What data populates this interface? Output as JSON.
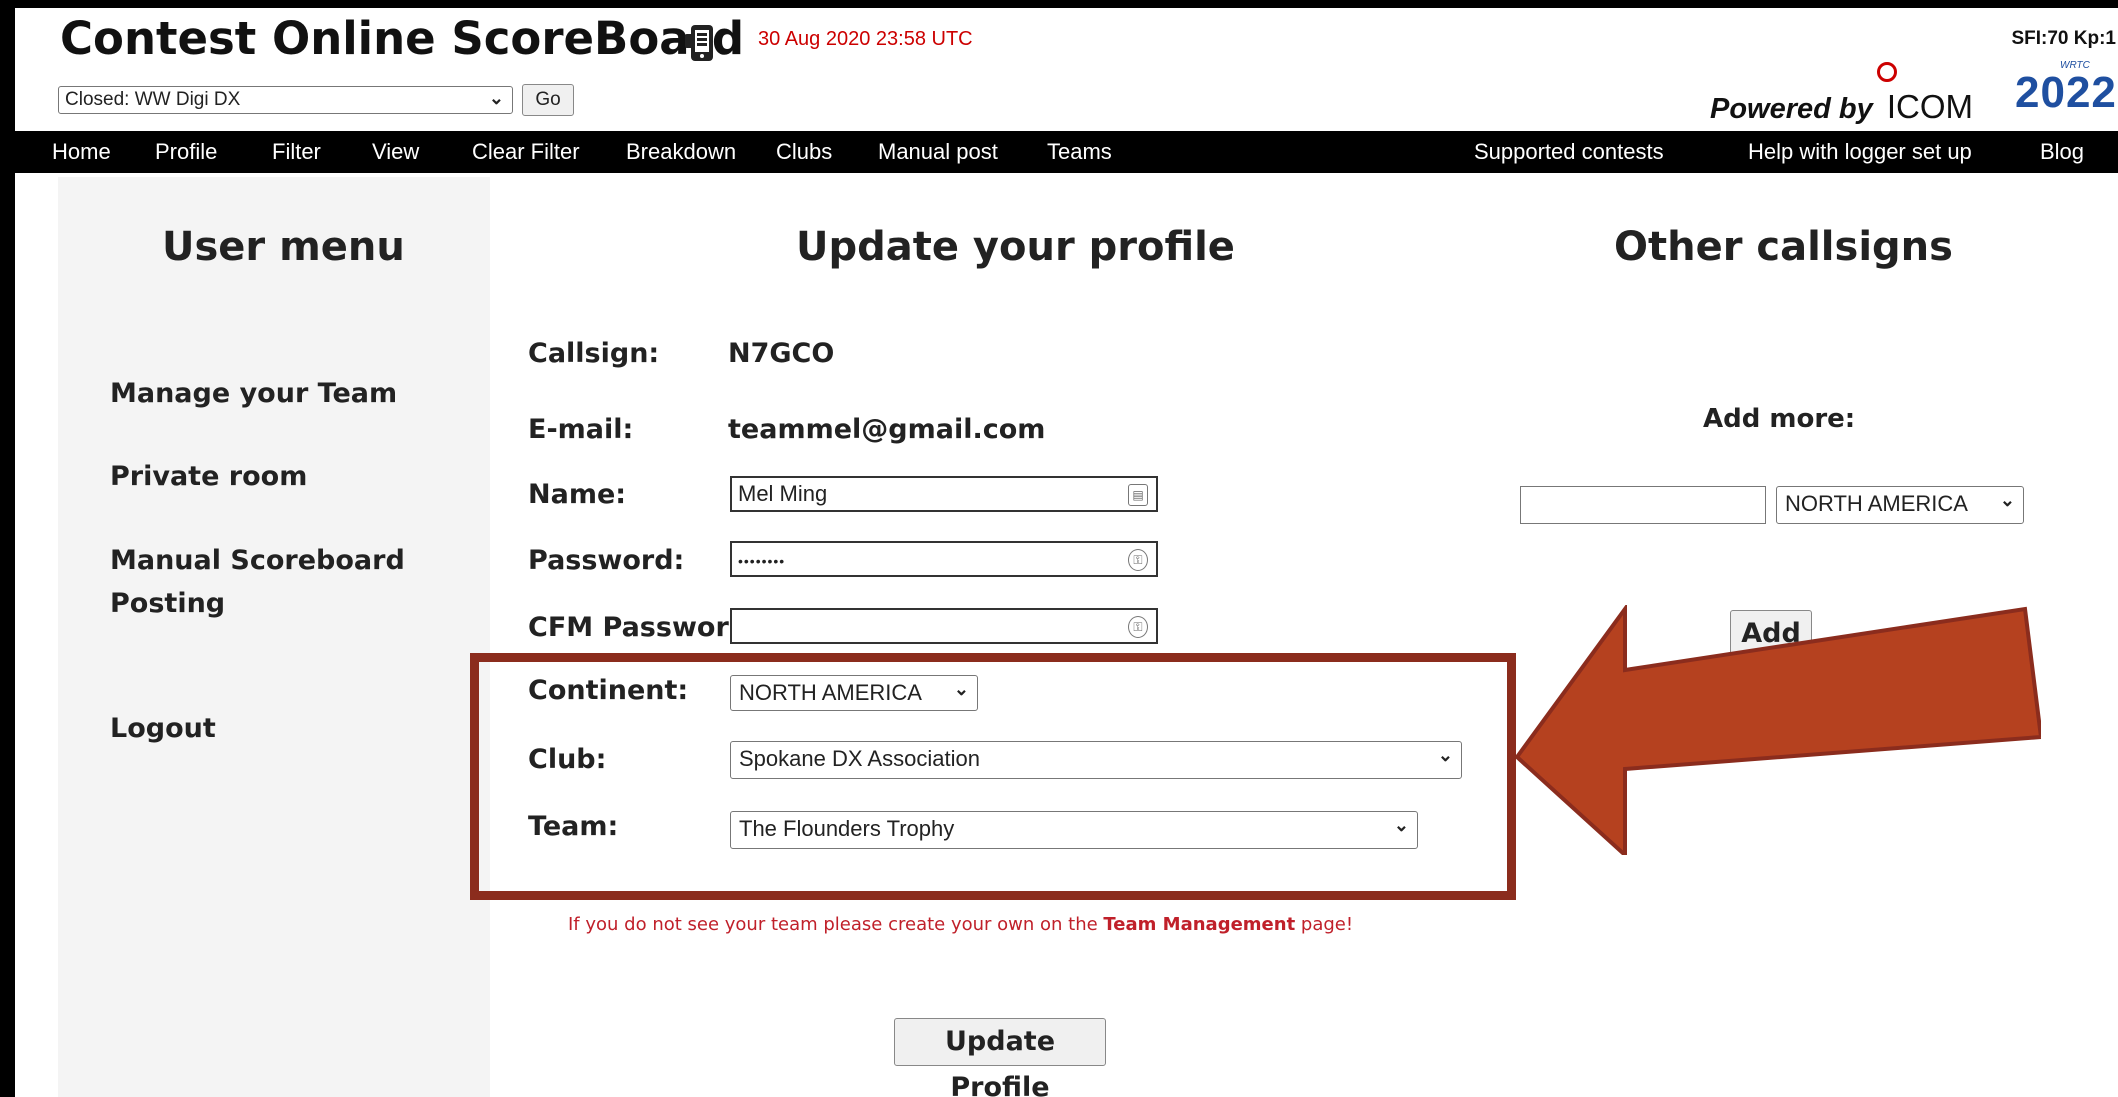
{
  "header": {
    "title": "Contest Online ScoreBoard",
    "datetime": "30 Aug 2020 23:58 UTC",
    "sfi": "SFI:70 Kp:1",
    "contest_select": "Closed: WW Digi DX",
    "go_label": "Go",
    "powered_by": "Powered by",
    "sponsor": "ICOM",
    "event_logo": "2022",
    "event_logo_small": "WRTC"
  },
  "nav": {
    "left": [
      "Home",
      "Profile",
      "Filter",
      "View",
      "Clear Filter",
      "Breakdown",
      "Clubs",
      "Manual post",
      "Teams"
    ],
    "right": [
      "Supported contests",
      "Help with logger set up",
      "Blog"
    ]
  },
  "user_menu": {
    "heading": "User menu",
    "items": [
      "Manage your Team",
      "Private room",
      "Manual Scoreboard Posting",
      "Logout"
    ]
  },
  "profile": {
    "heading": "Update your profile",
    "labels": {
      "callsign": "Callsign:",
      "email": "E-mail:",
      "name": "Name:",
      "password": "Password:",
      "cfm_password": "CFM Password:",
      "continent": "Continent:",
      "club": "Club:",
      "team": "Team:"
    },
    "values": {
      "callsign": "N7GCO",
      "email": "teammel@gmail.com",
      "name": "Mel Ming",
      "password": "••••••••",
      "cfm_password": "",
      "continent": "NORTH AMERICA",
      "club": "Spokane DX Association",
      "team": "The Flounders Trophy"
    },
    "hint_prefix": "If you do not see your team please create your own on the ",
    "hint_link": "Team Management",
    "hint_suffix": " page!",
    "update_button": "Update Profile"
  },
  "other_callsigns": {
    "heading": "Other callsigns",
    "add_more_label": "Add more:",
    "callsign_input": "",
    "continent": "NORTH AMERICA",
    "add_button": "Add"
  },
  "colors": {
    "annotation": "#b5411f",
    "annotation_border": "#8b2c1d",
    "hint_text": "#c0202a",
    "datetime_text": "#cc0000"
  }
}
